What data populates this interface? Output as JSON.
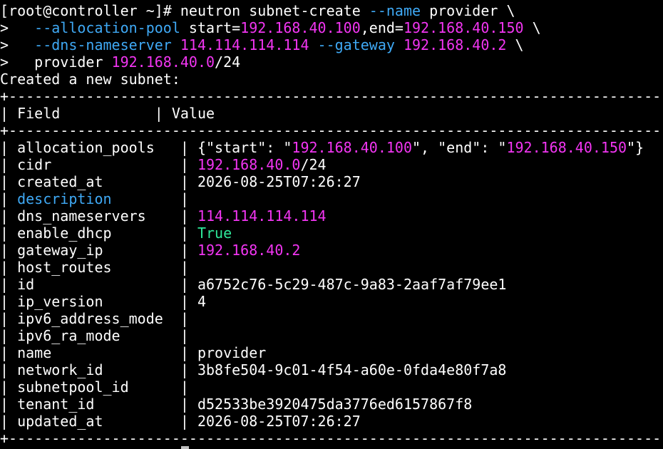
{
  "terminal": {
    "colors": {
      "background": "#000000",
      "text": "#ffffff",
      "option": "#3fa9f5",
      "ip": "#f235f2",
      "boolean_true": "#2ee89a"
    },
    "prompt": "[root@controller ~]# ",
    "cmd_base": "neutron subnet-create ",
    "opt_name": "--name",
    "name_value": " provider \\",
    "cont_prompt": ">   ",
    "opt_alloc": "--allocation-pool",
    "alloc_start": " start=",
    "alloc_start_ip": "192.168.40.100",
    "alloc_end_label": ",end=",
    "alloc_end_ip": "192.168.40.150",
    "alloc_tail": " \\",
    "opt_dns": "--dns-nameserver",
    "dns_ip": " 114.114.114.114 ",
    "opt_gateway": "--gateway",
    "gateway_ip": " 192.168.40.2",
    "gateway_tail": " \\",
    "cont_prompt2": ">   ",
    "network_name": "provider ",
    "cidr_ip": "192.168.40.0",
    "cidr_mask": "/24",
    "created_msg": "Created a new subnet:"
  },
  "table": {
    "border": "+-----------------------------------------------------------------------------------------+",
    "header_field": "Field",
    "header_value": "Value",
    "rows": [
      {
        "field": "allocation_pools",
        "v0": "{\"start\": \"",
        "v1": "192.168.40.100",
        "v2": "\", \"end\": \"",
        "v3": "192.168.40.150",
        "v4": "\"}"
      },
      {
        "field": "cidr",
        "v0": "",
        "v1": "192.168.40.0",
        "v2": "/24"
      },
      {
        "field": "created_at",
        "v0": "2026-08-25T07:26:27"
      },
      {
        "field": "description",
        "v0": ""
      },
      {
        "field": "dns_nameservers",
        "v1": "114.114.114.114"
      },
      {
        "field": "enable_dhcp",
        "v1": "True"
      },
      {
        "field": "gateway_ip",
        "v1": "192.168.40.2"
      },
      {
        "field": "host_routes",
        "v0": ""
      },
      {
        "field": "id",
        "v0": "a6752c76-5c29-487c-9a83-2aaf7af79ee1"
      },
      {
        "field": "ip_version",
        "v0": "4"
      },
      {
        "field": "ipv6_address_mode",
        "v0": ""
      },
      {
        "field": "ipv6_ra_mode",
        "v0": ""
      },
      {
        "field": "name",
        "v0": "provider"
      },
      {
        "field": "network_id",
        "v0": "3b8fe504-9c01-4f54-a60e-0fda4e80f7a8"
      },
      {
        "field": "subnetpool_id",
        "v0": ""
      },
      {
        "field": "tenant_id",
        "v0": "d52533be3920475da3776ed6157867f8"
      },
      {
        "field": "updated_at",
        "v0": "2026-08-25T07:26:27"
      }
    ]
  }
}
